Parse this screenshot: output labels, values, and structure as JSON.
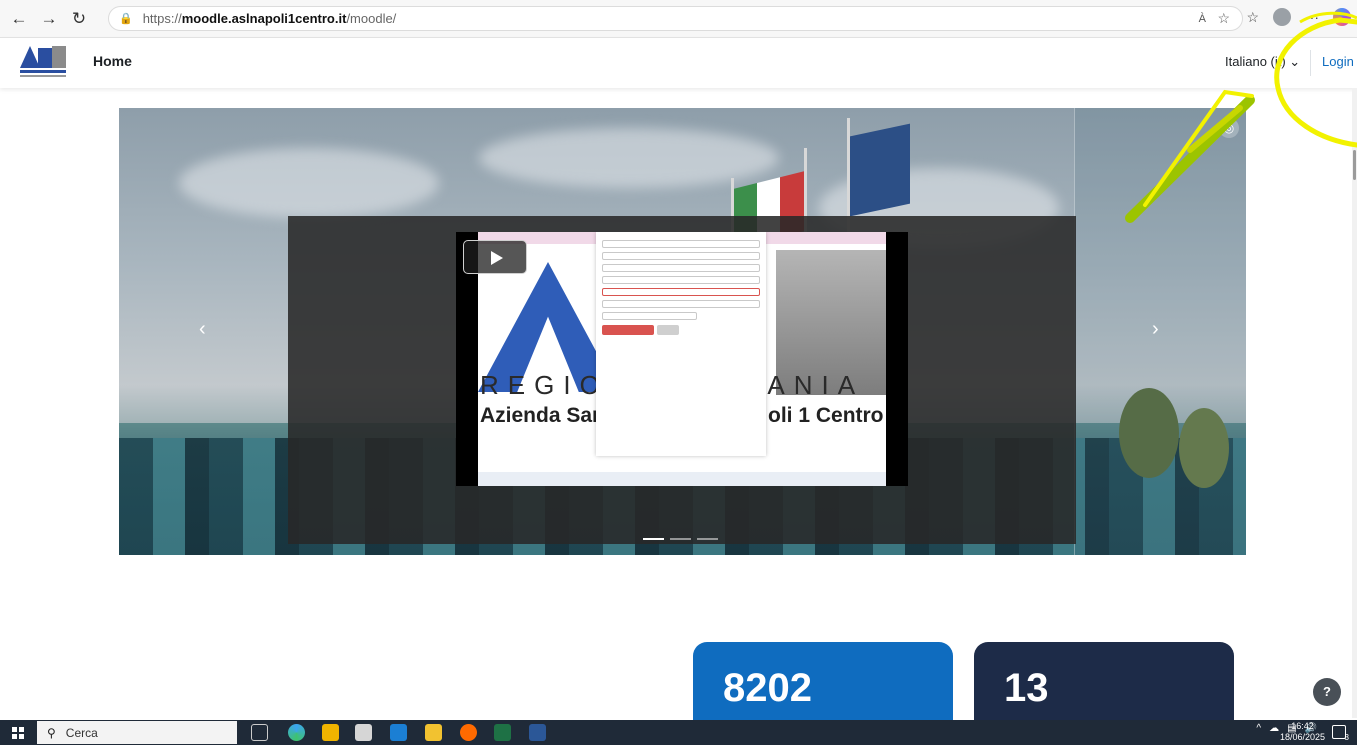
{
  "browser": {
    "url_prefix": "https://",
    "url_host": "moodle.aslnapoli1centro.it",
    "url_path": "/moodle/",
    "back_icon": "arrow-left-icon",
    "forward_icon": "arrow-right-icon",
    "refresh_icon": "refresh-icon",
    "read_aloud": "À",
    "more": "···"
  },
  "navbar": {
    "home_label": "Home",
    "language_label": "Italiano (it) ⌄",
    "login_label": "Login"
  },
  "carousel": {
    "prev_glyph": "‹",
    "next_glyph": "›",
    "indicators": [
      true,
      false,
      false
    ]
  },
  "video_frame": {
    "region_text_left": "REGIO",
    "region_text_right": "PANIA",
    "azienda_left": "Azienda San",
    "azienda_right": "oli 1 Centro"
  },
  "stats": {
    "card1_value": "8202",
    "card2_value": "13"
  },
  "help_label": "?",
  "taskbar": {
    "search_label": "Cerca",
    "time": "16:42",
    "date": "18/06/2025",
    "notif_count": "3"
  },
  "colors": {
    "primary": "#0f6cbf",
    "dark_card": "#1d2b48",
    "annotation": "#f2f200"
  }
}
